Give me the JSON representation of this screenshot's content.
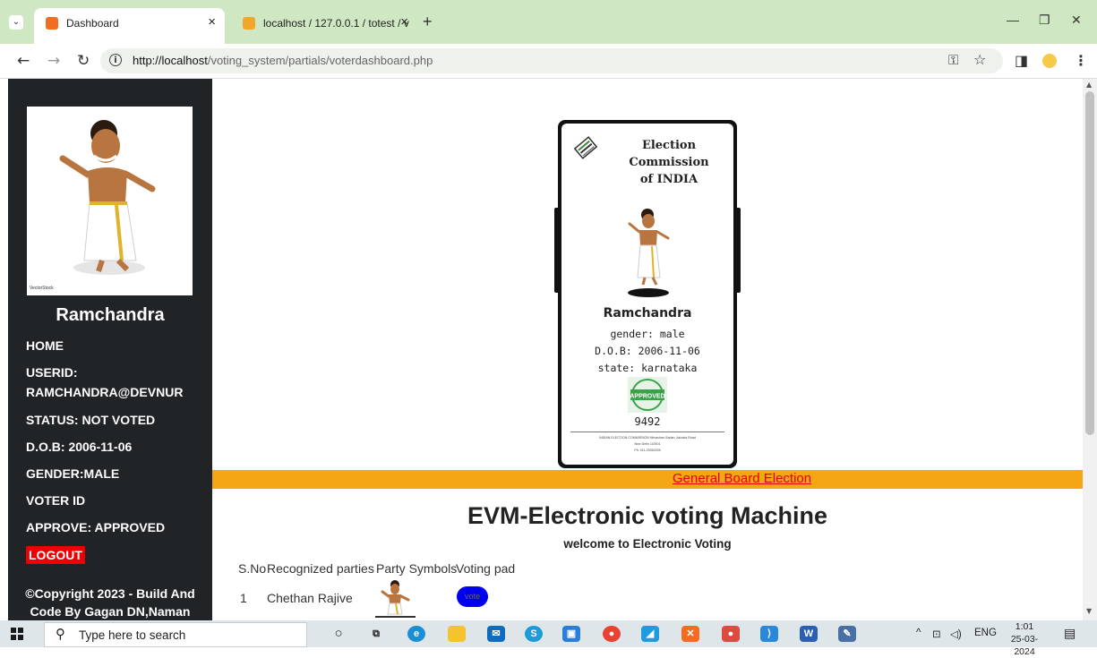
{
  "browser": {
    "tabs": [
      {
        "title": "Dashboard",
        "favicon": "xampp-icon",
        "active": true
      },
      {
        "title": "localhost / 127.0.0.1 / totest / v",
        "favicon": "phpmyadmin-icon",
        "active": false
      }
    ],
    "url_host": "http://localhost",
    "url_path": "/voting_system/partials/voterdashboard.php"
  },
  "sidebar": {
    "name": "Ramchandra",
    "avatar_caption": "VectorStock",
    "items": [
      {
        "label": "HOME"
      },
      {
        "label": "USERID:"
      },
      {
        "label": "RAMCHANDRA@DEVNUR"
      },
      {
        "label": "STATUS: NOT VOTED"
      },
      {
        "label": "D.O.B: 2006-11-06"
      },
      {
        "label": "GENDER:MALE"
      },
      {
        "label": "VOTER ID"
      },
      {
        "label": "APPROVE: APPROVED"
      }
    ],
    "logout": "LOGOUT",
    "copyright_line1": "©Copyright 2023 - Build And",
    "copyright_line2": "Code By Gagan DN,Naman"
  },
  "card": {
    "title_line1": "Election Commission",
    "title_line2": "of INDIA",
    "name": "Ramchandra",
    "gender": "gender: male",
    "dob": "D.O.B: 2006-11-06",
    "state": "state: karnataka",
    "stamp": "APPROVED",
    "number": "9492",
    "footer_line1": "INDIAN ELECTION COMMISSION Nirvachan Sadan, Ashoka Road",
    "footer_line2": "New Delhi 110001",
    "footer_line3": "Ph: 011-23052205"
  },
  "main": {
    "band_link": "General Board Election",
    "title": "EVM-Electronic voting Machine",
    "subtitle": "welcome to Electronic Voting",
    "columns": [
      "S.No",
      "Recognized parties",
      "Party Symbols",
      "Voting pad"
    ],
    "rows": [
      {
        "sno": "1",
        "party": "Chethan Rajive",
        "vote": "vote"
      }
    ]
  },
  "taskbar": {
    "search_placeholder": "Type here to search",
    "lang": "ENG",
    "time": "1:01",
    "date": "25-03-2024"
  }
}
